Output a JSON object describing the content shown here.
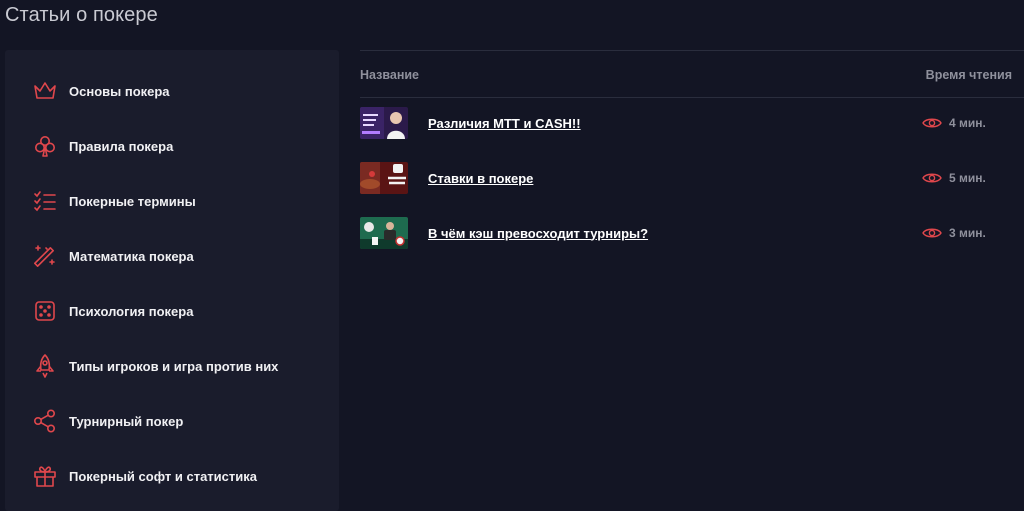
{
  "page": {
    "title": "Статьи о покере"
  },
  "colors": {
    "accent": "#e0474c",
    "background": "#131524",
    "panel": "#1a1c2c"
  },
  "sidebar": {
    "items": [
      {
        "label": "Основы покера",
        "icon": "crown-icon"
      },
      {
        "label": "Правила покера",
        "icon": "club-icon"
      },
      {
        "label": "Покерные термины",
        "icon": "checklist-icon"
      },
      {
        "label": "Математика покера",
        "icon": "magic-wand-icon"
      },
      {
        "label": "Психология покера",
        "icon": "dice-icon"
      },
      {
        "label": "Типы игроков и игра против них",
        "icon": "rocket-icon"
      },
      {
        "label": "Турнирный покер",
        "icon": "share-nodes-icon"
      },
      {
        "label": "Покерный софт и статистика",
        "icon": "gift-icon"
      }
    ]
  },
  "table": {
    "headers": {
      "name": "Название",
      "time": "Время чтения"
    },
    "rows": [
      {
        "title": "Различия МТТ и CASH!!",
        "time": "4 мин.",
        "thumb": "thumbnail-mtt-cash"
      },
      {
        "title": "Ставки в покере",
        "time": "5 мин.",
        "thumb": "thumbnail-bets"
      },
      {
        "title": "В чём кэш превосходит турниры?",
        "time": "3 мин.",
        "thumb": "thumbnail-cash-vs-tournaments"
      }
    ]
  }
}
